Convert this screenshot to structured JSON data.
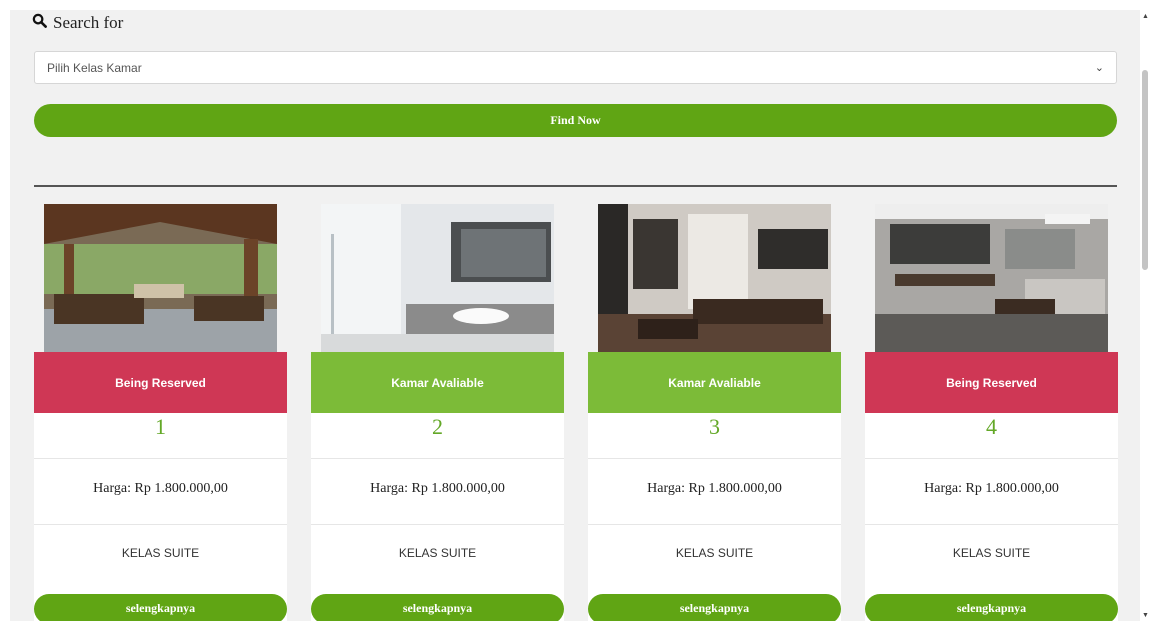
{
  "search": {
    "label": "Search for",
    "select_value": "Pilih Kelas Kamar",
    "button_label": "Find Now"
  },
  "rooms": [
    {
      "status": "Being Reserved",
      "status_color": "#cf3755",
      "number": "1",
      "price": "Harga: Rp 1.800.000,00",
      "kelas": "KELAS SUITE",
      "more_label": "selengkapnya"
    },
    {
      "status": "Kamar Avaliable",
      "status_color": "#7cbb38",
      "number": "2",
      "price": "Harga: Rp 1.800.000,00",
      "kelas": "KELAS SUITE",
      "more_label": "selengkapnya"
    },
    {
      "status": "Kamar Avaliable",
      "status_color": "#7cbb38",
      "number": "3",
      "price": "Harga: Rp 1.800.000,00",
      "kelas": "KELAS SUITE",
      "more_label": "selengkapnya"
    },
    {
      "status": "Being Reserved",
      "status_color": "#cf3755",
      "number": "4",
      "price": "Harga: Rp 1.800.000,00",
      "kelas": "KELAS SUITE",
      "more_label": "selengkapnya"
    }
  ],
  "colors": {
    "accent": "#60a514",
    "reserved": "#cf3755",
    "available": "#7cbb38"
  },
  "icons": {
    "search": "search-icon",
    "select": "chevron-down-icon"
  }
}
